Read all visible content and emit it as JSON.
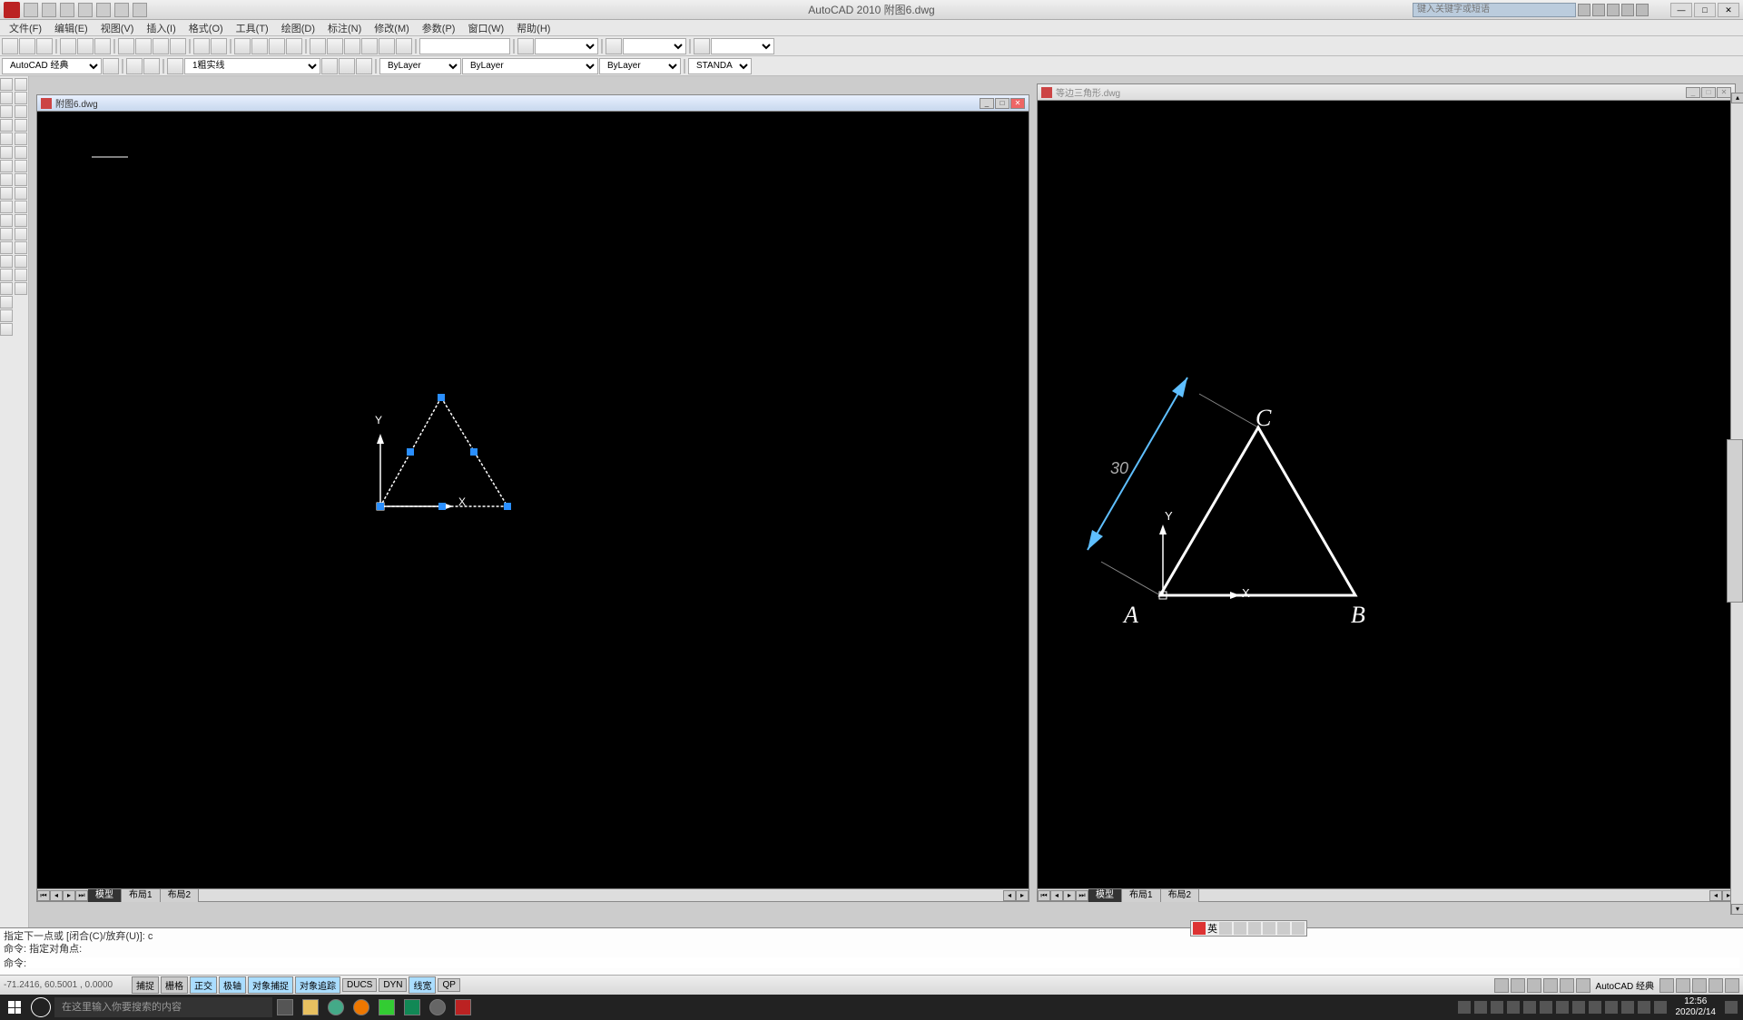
{
  "app": {
    "title": "AutoCAD 2010    附图6.dwg",
    "search_placeholder": "键入关键字或短语"
  },
  "menu": [
    "文件(F)",
    "编辑(E)",
    "视图(V)",
    "插入(I)",
    "格式(O)",
    "工具(T)",
    "绘图(D)",
    "标注(N)",
    "修改(M)",
    "参数(P)",
    "窗口(W)",
    "帮助(H)"
  ],
  "workspace": "AutoCAD 经典",
  "layer": "1粗实线",
  "color": "ByLayer",
  "linetype": "ByLayer",
  "dimstyle": "STANDA",
  "windows": {
    "left": {
      "title": "附图6.dwg",
      "tabs": {
        "model": "模型",
        "layout1": "布局1",
        "layout2": "布局2"
      }
    },
    "right": {
      "title": "等边三角形.dwg",
      "tabs": {
        "model": "模型",
        "layout1": "布局1",
        "layout2": "布局2"
      },
      "labels": {
        "A": "A",
        "B": "B",
        "C": "C",
        "dim": "30",
        "x": "X",
        "y": "Y"
      }
    }
  },
  "command": {
    "line1": "指定下一点或 [闭合(C)/放弃(U)]: c",
    "line2": "命令: 指定对角点:",
    "prompt": "命令:"
  },
  "status": {
    "coords": "-71.2416, 60.5001 , 0.0000",
    "buttons": [
      "捕捉",
      "栅格",
      "正交",
      "极轴",
      "对象捕捉",
      "对象追踪",
      "DUCS",
      "DYN",
      "线宽",
      "QP"
    ],
    "active": [
      2,
      3,
      4,
      5,
      8
    ],
    "workspace_label": "AutoCAD 经典"
  },
  "taskbar": {
    "search": "在这里输入你要搜索的内容",
    "time": "12:56",
    "date": "2020/2/14"
  },
  "ime": {
    "label": "英"
  },
  "canvas": {
    "left": {
      "y": "Y",
      "x": "X"
    },
    "right": {
      "y": "Y",
      "x": "X"
    }
  }
}
